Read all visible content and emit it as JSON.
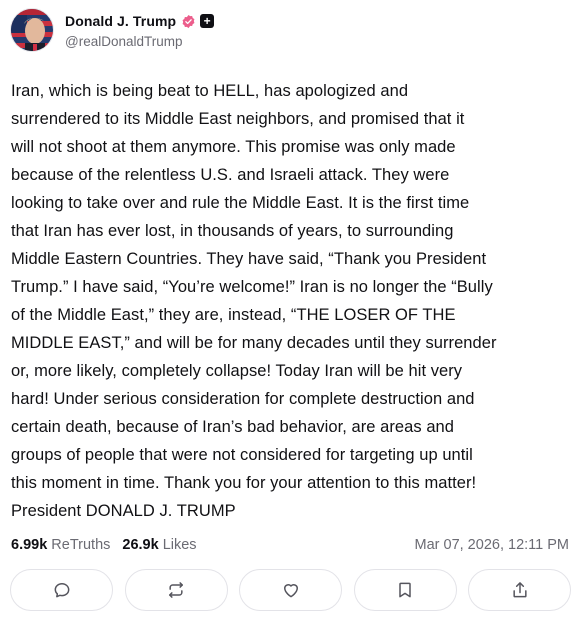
{
  "author": {
    "display_name": "Donald J. Trump",
    "handle": "@realDonaldTrump",
    "plus_badge": "+"
  },
  "post": {
    "text": "Iran, which is being beat to HELL, has apologized and\nsurrendered to its Middle East neighbors, and promised that it\nwill not shoot at them anymore. This promise was only made\nbecause of the relentless U.S. and Israeli attack. They were\nlooking to take over and rule the Middle East. It is the first time\nthat Iran has ever lost, in thousands of years, to surrounding\nMiddle Eastern Countries. They have said, “Thank you President\nTrump.” I have said, “You’re welcome!” Iran is no longer the “Bully\nof the Middle East,” they are, instead, “THE LOSER OF THE\nMIDDLE EAST,” and will be for many decades until they surrender\nor, more likely, completely collapse! Today Iran will be hit very\nhard! Under serious consideration for complete destruction and\ncertain death, because of Iran’s bad behavior, are areas and\ngroups of people that were not considered for targeting up until\nthis moment in time. Thank you for your attention to this matter!\nPresident DONALD J. TRUMP"
  },
  "stats": {
    "retruths_count": "6.99k",
    "retruths_label": "ReTruths",
    "likes_count": "26.9k",
    "likes_label": "Likes",
    "timestamp": "Mar 07, 2026, 12:11 PM"
  },
  "actions": [
    {
      "name": "reply",
      "icon": "chat-bubble-icon"
    },
    {
      "name": "retruth",
      "icon": "repost-icon"
    },
    {
      "name": "like",
      "icon": "heart-icon"
    },
    {
      "name": "bookmark",
      "icon": "bookmark-icon"
    },
    {
      "name": "share",
      "icon": "share-icon"
    }
  ],
  "colors": {
    "verified": "#ec5e8c",
    "muted_text": "#6b6b73",
    "border": "#e3e3e8"
  }
}
